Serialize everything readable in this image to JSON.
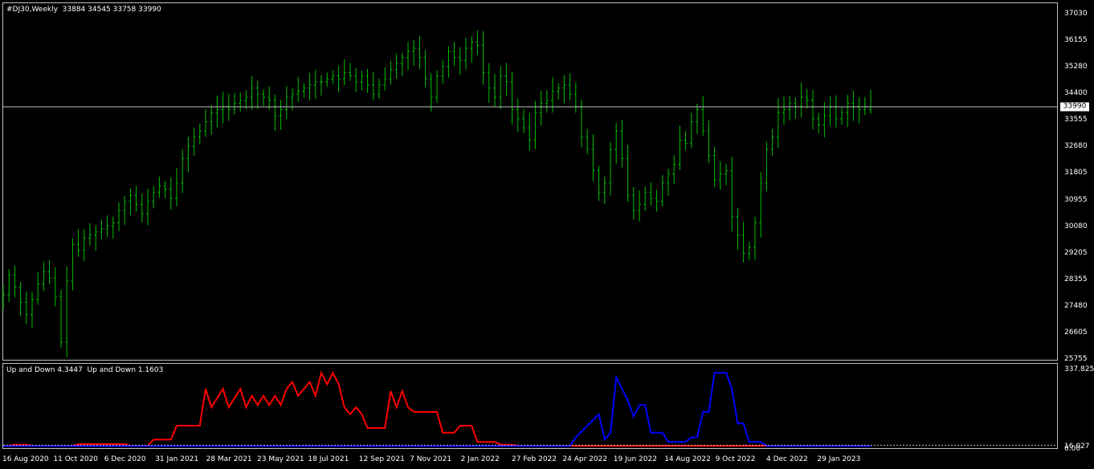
{
  "main_title": "#DJ30,Weekly  33884 34545 33758 33990",
  "indicator_title": "Up and Down 4.3447  Up and Down 1.1603",
  "current_price_label": "33990",
  "price_axis_labels": [
    "37030",
    "36155",
    "35280",
    "34400",
    "33555",
    "32680",
    "31805",
    "30955",
    "30080",
    "29205",
    "28355",
    "27480",
    "26605",
    "25755"
  ],
  "indicator_axis_labels": {
    "top": "337.825",
    "mid": "16.027",
    "bottom": "0.00"
  },
  "x_axis_labels": [
    "16 Aug 2020",
    "11 Oct 2020",
    "6 Dec 2020",
    "31 Jan 2021",
    "28 Mar 2021",
    "23 May 2021",
    "18 Jul 2021",
    "12 Sep 2021",
    "7 Nov 2021",
    "2 Jan 2022",
    "27 Feb 2022",
    "24 Apr 2022",
    "19 Jun 2022",
    "14 Aug 2022",
    "9 Oct 2022",
    "4 Dec 2022",
    "29 Jan 2023"
  ],
  "colors": {
    "bars": "#00c000",
    "up_line": "#ff0000",
    "down_line": "#0000ff",
    "price_line": "#c0c0c0"
  },
  "chart_data": {
    "type": "ohlc",
    "symbol": "#DJ30",
    "timeframe": "Weekly",
    "ylim": [
      25755,
      37030
    ],
    "last": {
      "open": 33884,
      "high": 34545,
      "low": 33758,
      "close": 33990
    },
    "closes": [
      27850,
      28500,
      28100,
      27600,
      27200,
      27700,
      28200,
      28600,
      28400,
      27800,
      26300,
      28300,
      29500,
      29300,
      29700,
      29800,
      29900,
      30000,
      30100,
      30200,
      30600,
      30900,
      31100,
      30800,
      30500,
      30900,
      31200,
      31400,
      31300,
      31000,
      31500,
      32300,
      32700,
      33000,
      33200,
      33500,
      33800,
      33900,
      34000,
      33900,
      34100,
      34200,
      34300,
      34600,
      34400,
      34300,
      34200,
      33700,
      33900,
      34300,
      34400,
      34500,
      34600,
      34700,
      34800,
      34800,
      34900,
      35000,
      34900,
      35100,
      35000,
      34800,
      35000,
      34700,
      34400,
      34700,
      34900,
      35200,
      35400,
      35600,
      35800,
      35900,
      35600,
      34900,
      34300,
      35000,
      35300,
      35800,
      35600,
      35500,
      35900,
      36100,
      36000,
      35100,
      34600,
      34300,
      35000,
      34800,
      33900,
      33600,
      33300,
      32900,
      33800,
      34100,
      34200,
      34500,
      34600,
      34700,
      34400,
      34000,
      33000,
      32600,
      31900,
      31200,
      31500,
      32600,
      33200,
      32300,
      31100,
      30600,
      30800,
      31200,
      31000,
      30900,
      31500,
      31800,
      32100,
      32900,
      32800,
      33500,
      33900,
      33200,
      32400,
      31600,
      31800,
      31900,
      30400,
      29800,
      29200,
      29400,
      30200,
      31500,
      32600,
      33000,
      33800,
      33900,
      34100,
      34000,
      34300,
      34200,
      33600,
      33400,
      33700,
      34000,
      33600,
      33800,
      34100,
      34000,
      33900,
      34000,
      33990
    ],
    "indicator": {
      "series": [
        {
          "name": "Up and Down",
          "value": 4.3447,
          "color": "#ff0000"
        },
        {
          "name": "Up and Down",
          "value": 1.1603,
          "color": "#0000ff"
        }
      ],
      "ylim": [
        0,
        337.825
      ],
      "level": 16.027
    }
  }
}
